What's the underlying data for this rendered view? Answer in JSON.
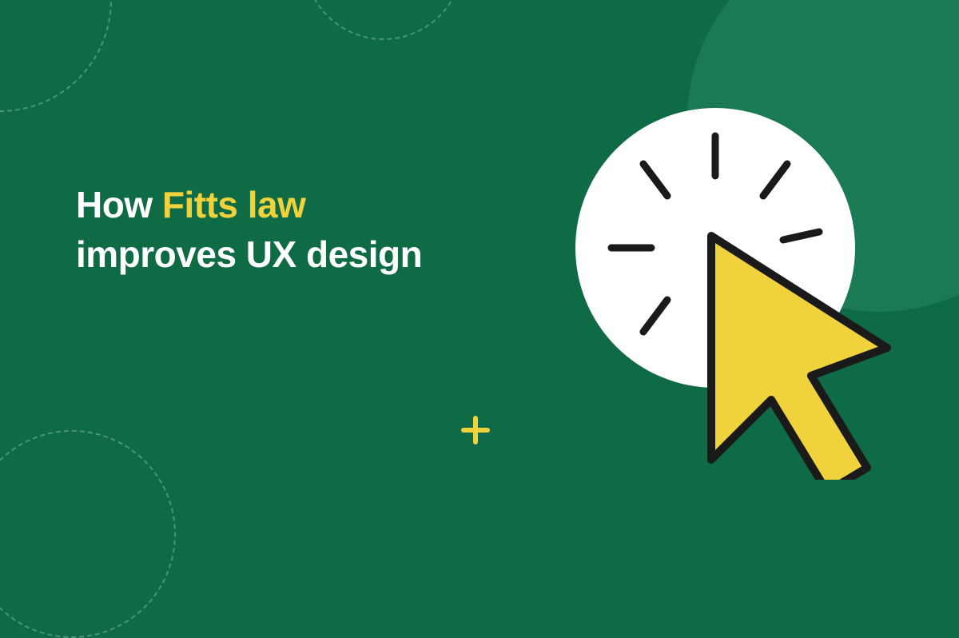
{
  "headline": {
    "part1": "How ",
    "highlight": "Fitts law",
    "part2": "improves UX design"
  },
  "colors": {
    "background": "#0e6b46",
    "accent": "#f0d23c",
    "text": "#ffffff",
    "stroke": "#1a1a1a"
  }
}
